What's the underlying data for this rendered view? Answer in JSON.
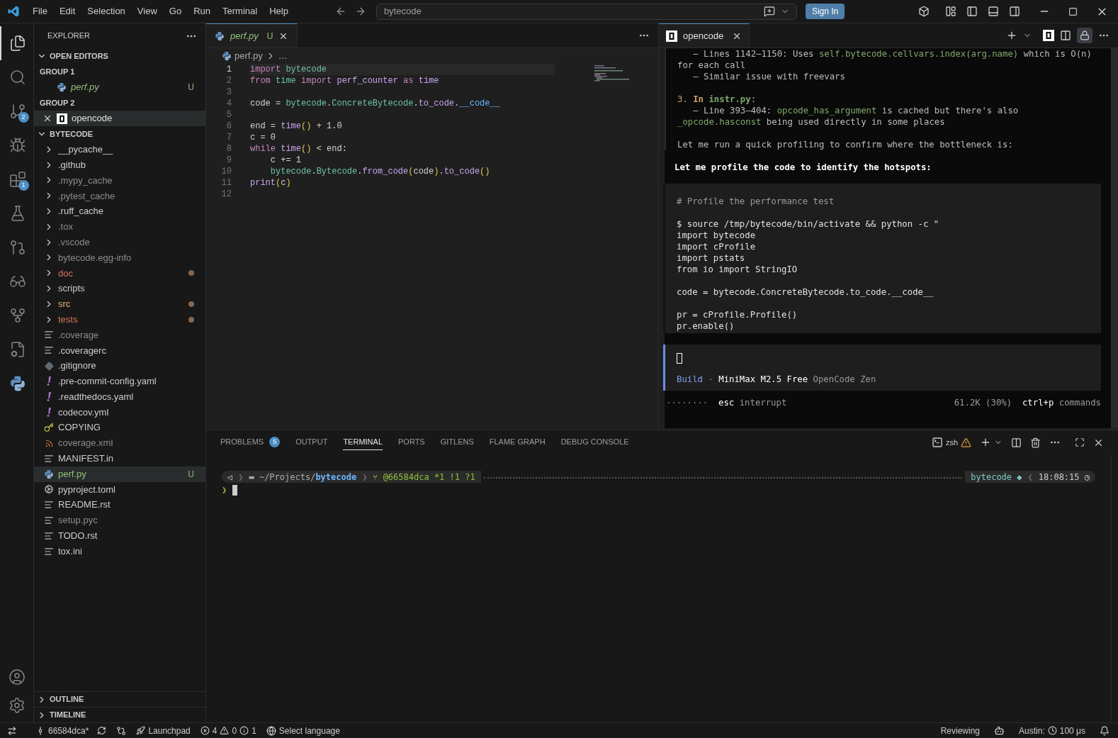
{
  "menu": [
    "File",
    "Edit",
    "Selection",
    "View",
    "Go",
    "Run",
    "Terminal",
    "Help"
  ],
  "command_center": {
    "value": "bytecode"
  },
  "sign_in": "Sign In",
  "activity": [
    {
      "selected": true
    },
    {
      "selected": false
    },
    {
      "selected": false,
      "badge": "2"
    },
    {
      "selected": false
    },
    {
      "selected": false,
      "badge": "1"
    },
    {
      "selected": false
    },
    {
      "selected": false
    },
    {
      "selected": false
    },
    {
      "selected": false
    },
    {
      "selected": false
    },
    {
      "selected": false
    }
  ],
  "explorer": {
    "title": "EXPLORER",
    "open_editors": {
      "label": "OPEN EDITORS",
      "expanded": true,
      "groups": [
        {
          "label": "GROUP 1",
          "items": [
            {
              "name": "perf.py",
              "kind": "python",
              "badge": "U",
              "selected": false
            }
          ]
        },
        {
          "label": "GROUP 2",
          "items": [
            {
              "name": "opencode",
              "kind": "terminal",
              "selected": true
            }
          ]
        }
      ]
    },
    "folder": {
      "label": "BYTECODE",
      "expanded": true,
      "items": [
        {
          "name": "__pycache__",
          "kind": "folder",
          "color": "#cccccc",
          "dot": false,
          "selected": false
        },
        {
          "name": ".github",
          "kind": "folder",
          "color": "#cccccc",
          "dot": false,
          "selected": false
        },
        {
          "name": ".mypy_cache",
          "kind": "folder",
          "color": "#8c8c8c",
          "dot": false,
          "selected": false
        },
        {
          "name": ".pytest_cache",
          "kind": "folder",
          "color": "#8c8c8c",
          "dot": false,
          "selected": false
        },
        {
          "name": ".ruff_cache",
          "kind": "folder",
          "color": "#cccccc",
          "dot": false,
          "selected": false
        },
        {
          "name": ".tox",
          "kind": "folder",
          "color": "#8c8c8c",
          "dot": false,
          "selected": false
        },
        {
          "name": ".vscode",
          "kind": "folder",
          "color": "#8c8c8c",
          "dot": false,
          "selected": false
        },
        {
          "name": "bytecode.egg-info",
          "kind": "folder",
          "color": "#8c8c8c",
          "dot": false,
          "selected": false
        },
        {
          "name": "doc",
          "kind": "folder",
          "color": "#d6735e",
          "dot": true,
          "selected": false
        },
        {
          "name": "scripts",
          "kind": "folder",
          "color": "#cccccc",
          "dot": false,
          "selected": false
        },
        {
          "name": "src",
          "kind": "folder",
          "color": "#d9b46e",
          "dot": true,
          "selected": false
        },
        {
          "name": "tests",
          "kind": "folder",
          "color": "#d6735e",
          "dot": true,
          "selected": false
        },
        {
          "name": ".coverage",
          "kind": "text",
          "color": "#8c8c8c",
          "dot": false,
          "selected": false
        },
        {
          "name": ".coveragerc",
          "kind": "text",
          "color": "#cccccc",
          "dot": false,
          "selected": false
        },
        {
          "name": ".gitignore",
          "kind": "git",
          "color": "#cccccc",
          "dot": false,
          "selected": false
        },
        {
          "name": ".pre-commit-config.yaml",
          "kind": "yaml",
          "color": "#cccccc",
          "dot": false,
          "selected": false
        },
        {
          "name": ".readthedocs.yaml",
          "kind": "yaml",
          "color": "#cccccc",
          "dot": false,
          "selected": false
        },
        {
          "name": "codecov.yml",
          "kind": "yaml",
          "color": "#cccccc",
          "dot": false,
          "selected": false
        },
        {
          "name": "COPYING",
          "kind": "license",
          "color": "#cccccc",
          "dot": false,
          "selected": false
        },
        {
          "name": "coverage.xml",
          "kind": "xml",
          "color": "#8c8c8c",
          "dot": false,
          "selected": false
        },
        {
          "name": "MANIFEST.in",
          "kind": "text",
          "color": "#cccccc",
          "dot": false,
          "selected": false
        },
        {
          "name": "perf.py",
          "kind": "python",
          "color": "#8fc27a",
          "dot": false,
          "badge": "U",
          "selected": true
        },
        {
          "name": "pyproject.toml",
          "kind": "config",
          "color": "#cccccc",
          "dot": false,
          "selected": false
        },
        {
          "name": "README.rst",
          "kind": "text",
          "color": "#cccccc",
          "dot": false,
          "selected": false
        },
        {
          "name": "setup.pyc",
          "kind": "text",
          "color": "#8c8c8c",
          "dot": false,
          "selected": false
        },
        {
          "name": "TODO.rst",
          "kind": "text",
          "color": "#cccccc",
          "dot": false,
          "selected": false
        },
        {
          "name": "tox.ini",
          "kind": "text",
          "color": "#cccccc",
          "dot": false,
          "selected": false
        }
      ]
    },
    "outline": "OUTLINE",
    "timeline": "TIMELINE"
  },
  "editor": {
    "tab": {
      "name": "perf.py",
      "badge": "U"
    },
    "breadcrumb": [
      "perf.py",
      "…"
    ],
    "lines": [
      {
        "number": "1",
        "selected": true,
        "tokens": [
          {
            "text": "import ",
            "kind": "kw"
          },
          {
            "text": "bytecode",
            "kind": "mod"
          }
        ]
      },
      {
        "number": "2",
        "selected": false,
        "tokens": [
          {
            "text": "from ",
            "kind": "kw"
          },
          {
            "text": "time ",
            "kind": "mod"
          },
          {
            "text": "import ",
            "kind": "kw"
          },
          {
            "text": "perf_counter ",
            "kind": "fn"
          },
          {
            "text": "as ",
            "kind": "kw"
          },
          {
            "text": "time",
            "kind": "fn"
          }
        ]
      },
      {
        "number": "3",
        "selected": false
      },
      {
        "number": "4",
        "selected": false,
        "tokens": [
          {
            "text": "code = "
          },
          {
            "text": "bytecode",
            "kind": "mod"
          },
          {
            "text": "."
          },
          {
            "text": "ConcreteBytecode",
            "kind": "mod"
          },
          {
            "text": "."
          },
          {
            "text": "to_code",
            "kind": "fn"
          },
          {
            "text": "."
          },
          {
            "text": "__code__",
            "kind": "attr"
          }
        ]
      },
      {
        "number": "5",
        "selected": false
      },
      {
        "number": "6",
        "selected": false,
        "tokens": [
          {
            "text": "end = "
          },
          {
            "text": "time",
            "kind": "fn"
          },
          {
            "text": "()",
            "kind": "paren"
          },
          {
            "text": " + 1.0"
          }
        ]
      },
      {
        "number": "7",
        "selected": false,
        "tokens": [
          {
            "text": "c = 0"
          }
        ]
      },
      {
        "number": "8",
        "selected": false,
        "tokens": [
          {
            "text": "while ",
            "kind": "kw"
          },
          {
            "text": "time",
            "kind": "fn"
          },
          {
            "text": "()",
            "kind": "paren"
          },
          {
            "text": " < end:"
          }
        ]
      },
      {
        "number": "9",
        "selected": false,
        "tokens": [
          {
            "text": "    c += 1"
          }
        ]
      },
      {
        "number": "10",
        "selected": false,
        "tokens": [
          {
            "text": "    bytecode",
            "kind": "mod"
          },
          {
            "text": "."
          },
          {
            "text": "Bytecode",
            "kind": "mod"
          },
          {
            "text": "."
          },
          {
            "text": "from_code",
            "kind": "fn"
          },
          {
            "text": "(",
            "kind": "paren"
          },
          {
            "text": "code"
          },
          {
            "text": ")",
            "kind": "paren"
          },
          {
            "text": "."
          },
          {
            "text": "to_code",
            "kind": "fn"
          },
          {
            "text": "()",
            "kind": "paren"
          }
        ]
      },
      {
        "number": "11",
        "selected": false,
        "tokens": [
          {
            "text": "print",
            "kind": "fn"
          },
          {
            "text": "(",
            "kind": "paren"
          },
          {
            "text": "c"
          },
          {
            "text": ")",
            "kind": "paren"
          }
        ]
      },
      {
        "number": "12",
        "selected": false
      }
    ]
  },
  "opencode": {
    "tab": "opencode",
    "quoted": [
      [
        [
          {
            "text": "   – Lines 1142–1150: Uses "
          },
          {
            "text": "self.bytecode.cellvars.index(arg.name)",
            "kind": "code"
          },
          {
            "text": " which is O(n) for each call"
          }
        ],
        [
          {
            "text": "   – Similar issue with freevars"
          }
        ]
      ],
      [
        [
          {
            "text": "3. ",
            "kind": "num"
          },
          {
            "text": "In ",
            "kind": "numbold"
          },
          {
            "text": "instr.py",
            "kind": "codebold"
          },
          {
            "text": ":"
          }
        ],
        [
          {
            "text": "   – Line 393–404: "
          },
          {
            "text": "opcode_has_argument",
            "kind": "code"
          },
          {
            "text": " is cached but there's also "
          },
          {
            "text": "_opcode.hasconst",
            "kind": "code"
          },
          {
            "text": " being used directly in some places"
          }
        ]
      ],
      [
        [
          {
            "text": "Let me run a quick profiling to confirm where the bottleneck is:"
          }
        ]
      ]
    ],
    "bold_line": "Let me profile the code to identify the hotspots:",
    "code_block": [
      [
        "# Profile the performance test"
      ],
      [
        "$ source /tmp/bytecode/bin/activate && python -c \"",
        "import bytecode",
        "import cProfile",
        "import pstats",
        "from io import StringIO"
      ],
      [
        "code = bytecode.ConcreteBytecode.to_code.__code__"
      ],
      [
        "pr = cProfile.Profile()",
        "pr.enable()"
      ]
    ],
    "prompt": {
      "mode": "Build",
      "separator": "·",
      "model": "MiniMax M2.5 Free",
      "provider": "OpenCode Zen"
    },
    "footer": {
      "spinner": "········",
      "key1": "esc",
      "action1": "interrupt",
      "usage": "61.2K (30%)",
      "key2": "ctrl+p",
      "action2": "commands"
    }
  },
  "panel": {
    "tabs": [
      {
        "label": "PROBLEMS",
        "badge": "5",
        "selected": false
      },
      {
        "label": "OUTPUT",
        "selected": false
      },
      {
        "label": "TERMINAL",
        "selected": true
      },
      {
        "label": "PORTS",
        "selected": false
      },
      {
        "label": "GITLENS",
        "selected": false
      },
      {
        "label": "FLAME GRAPH",
        "selected": false
      },
      {
        "label": "DEBUG CONSOLE",
        "selected": false
      }
    ],
    "shell": "zsh",
    "terminal": {
      "left": [
        {
          "text": "◁"
        },
        {
          "text": "❯",
          "kind": "sep"
        },
        {
          "text": "▬ ~/Projects/",
          "kind": "path"
        },
        {
          "text": "bytecode",
          "kind": "dir"
        },
        {
          "text": "❯",
          "kind": "sep"
        },
        {
          "text": "⑂ @66584dca *1 !1 ?1",
          "kind": "git"
        }
      ],
      "right": [
        {
          "text": "bytecode ◆",
          "kind": "env"
        },
        {
          "text": "❮",
          "kind": "sep"
        },
        {
          "text": "18:08:15 ◷"
        }
      ],
      "prompt_char": "❯"
    }
  },
  "status": {
    "branch": "66584dca*",
    "launchpad": "Launchpad",
    "errors": "4",
    "warnings": "0",
    "infos": "1",
    "language": "Select language",
    "review": "Reviewing",
    "profiler": "Austin:",
    "profiler_value": "100 μs"
  }
}
